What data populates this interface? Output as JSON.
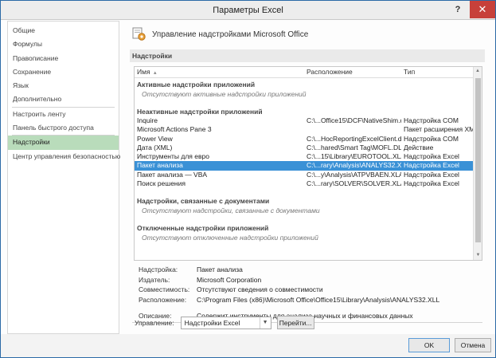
{
  "window": {
    "title": "Параметры Excel",
    "help": "?",
    "close": "✕"
  },
  "sidebar": {
    "items": [
      {
        "label": "Общие"
      },
      {
        "label": "Формулы"
      },
      {
        "label": "Правописание"
      },
      {
        "label": "Сохранение"
      },
      {
        "label": "Язык"
      },
      {
        "label": "Дополнительно"
      },
      {
        "label": "Настроить ленту"
      },
      {
        "label": "Панель быстрого доступа"
      },
      {
        "label": "Надстройки",
        "active": true
      },
      {
        "label": "Центр управления безопасностью"
      }
    ]
  },
  "main": {
    "heading": "Управление надстройками Microsoft Office",
    "icon": "gear-addins-icon",
    "section_title": "Надстройки"
  },
  "list": {
    "columns": {
      "name": "Имя",
      "sort": "▴",
      "location": "Расположение",
      "type": "Тип"
    },
    "groups": {
      "active": {
        "title": "Активные надстройки приложений",
        "empty": "Отсутствуют активные надстройки приложений"
      },
      "inactive": {
        "title": "Неактивные надстройки приложений",
        "rows": [
          {
            "name": "Inquire",
            "location": "C:\\...Office15\\DCF\\NativeShim.dll",
            "type": "Надстройка COM"
          },
          {
            "name": "Microsoft Actions Pane 3",
            "location": "",
            "type": "Пакет расширения XML"
          },
          {
            "name": "Power View",
            "location": "C:\\...HocReportingExcelClient.dll",
            "type": "Надстройка COM"
          },
          {
            "name": "Дата (XML)",
            "location": "C:\\...hared\\Smart Tag\\MOFL.DLL",
            "type": "Действие"
          },
          {
            "name": "Инструменты для евро",
            "location": "C:\\...15\\Library\\EUROTOOL.XLAM",
            "type": "Надстройка Excel"
          },
          {
            "name": "Пакет анализа",
            "location": "C:\\...rary\\Analysis\\ANALYS32.XLL",
            "type": "Надстройка Excel"
          },
          {
            "name": "Пакет анализа — VBA",
            "location": "C:\\...y\\Analysis\\ATPVBAEN.XLAM",
            "type": "Надстройка Excel"
          },
          {
            "name": "Поиск решения",
            "location": "C:\\...rary\\SOLVER\\SOLVER.XLAM",
            "type": "Надстройка Excel"
          }
        ]
      },
      "document": {
        "title": "Надстройки, связанные с документами",
        "empty": "Отсутствуют надстройки, связанные с документами"
      },
      "disabled": {
        "title": "Отключенные надстройки приложений",
        "empty": "Отсутствуют отключенные надстройки приложений"
      }
    }
  },
  "details": {
    "addin_label": "Надстройка:",
    "addin_value": "Пакет анализа",
    "publisher_label": "Издатель:",
    "publisher_value": "Microsoft Corporation",
    "compat_label": "Совместимость:",
    "compat_value": "Отсутствуют сведения о совместимости",
    "location_label": "Расположение:",
    "location_value": "C:\\Program Files (x86)\\Microsoft Office\\Office15\\Library\\Analysis\\ANALYS32.XLL",
    "desc_label": "Описание:",
    "desc_value": "Содержит инструменты для анализа научных и финансовых данных"
  },
  "manage": {
    "label": "Управление:",
    "selected": "Надстройки Excel",
    "go_label": "Перейти..."
  },
  "buttons": {
    "ok": "OK",
    "cancel": "Отмена"
  },
  "colors": {
    "selection": "#3a91d6",
    "nav_active": "#b9dcbb",
    "close": "#c7403a"
  }
}
